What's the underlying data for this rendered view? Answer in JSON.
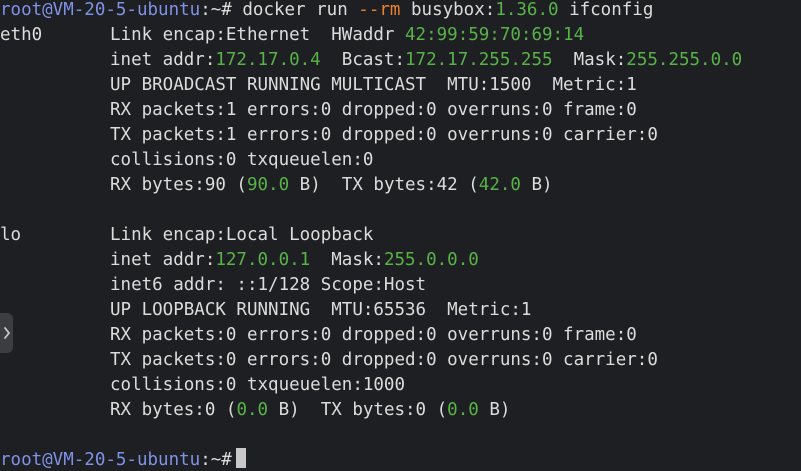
{
  "prompt": {
    "user_host": "root@VM-20-5-ubuntu",
    "separator": ":",
    "path": "~",
    "symbol": "#"
  },
  "command": {
    "docker": "docker",
    "run": "run",
    "flag": "--rm",
    "image_name": "busybox",
    "tag_sep": ":",
    "tag": "1.36.0",
    "arg": "ifconfig"
  },
  "eth0": {
    "name": "eth0",
    "line1_a": "Link encap:Ethernet  HWaddr ",
    "hwaddr": "42:99:59:70:69:14",
    "inet_label": "inet addr:",
    "inet": "172.17.0.4",
    "bcast_label": "  Bcast:",
    "bcast": "172.17.255.255",
    "mask_label": "  Mask:",
    "mask": "255.255.0.0",
    "flags": "UP BROADCAST RUNNING MULTICAST  MTU:1500  Metric:1",
    "rx_packets": "RX packets:1 errors:0 dropped:0 overruns:0 frame:0",
    "tx_packets": "TX packets:1 errors:0 dropped:0 overruns:0 carrier:0",
    "collisions": "collisions:0 txqueuelen:0",
    "rx_bytes_label": "RX bytes:90 (",
    "rx_bytes_val": "90.0",
    "rx_bytes_unit": " B)  TX bytes:42 (",
    "tx_bytes_val": "42.0",
    "tx_bytes_unit": " B)"
  },
  "lo": {
    "name": "lo",
    "line1": "Link encap:Local Loopback",
    "inet_label": "inet addr:",
    "inet": "127.0.0.1",
    "mask_label": "  Mask:",
    "mask": "255.0.0.0",
    "inet6": "inet6 addr: ::1/128 Scope:Host",
    "flags": "UP LOOPBACK RUNNING  MTU:65536  Metric:1",
    "rx_packets": "RX packets:0 errors:0 dropped:0 overruns:0 frame:0",
    "tx_packets": "TX packets:0 errors:0 dropped:0 overruns:0 carrier:0",
    "collisions": "collisions:0 txqueuelen:1000",
    "rx_bytes_label": "RX bytes:0 (",
    "rx_bytes_val": "0.0",
    "rx_bytes_unit": " B)  TX bytes:0 (",
    "tx_bytes_val": "0.0",
    "tx_bytes_unit": " B)"
  },
  "colors": {
    "background": "#1e1f22",
    "text": "#dcdcdc",
    "prompt_user": "#7f92e6",
    "flag": "#e9822f",
    "number": "#58b248"
  },
  "icons": {
    "side_handle": "chevron-right-icon"
  }
}
